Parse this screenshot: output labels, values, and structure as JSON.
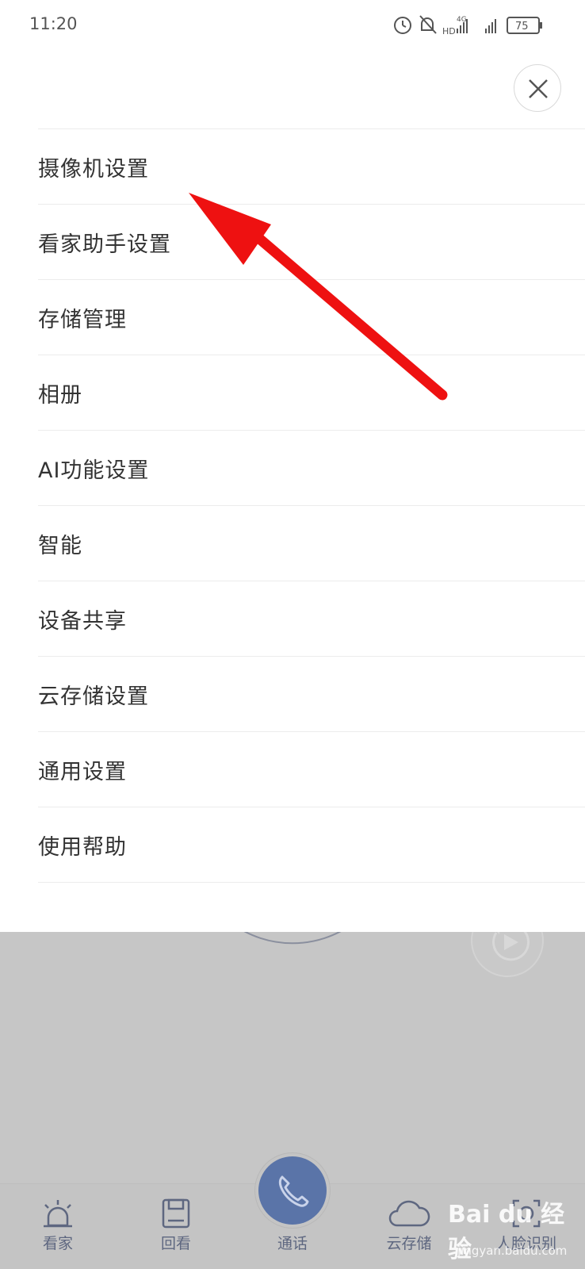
{
  "status_bar": {
    "time": "11:20",
    "network_label": "4G",
    "hd_label": "HD",
    "battery": "75"
  },
  "menu": {
    "items": [
      {
        "label": "摄像机设置"
      },
      {
        "label": "看家助手设置"
      },
      {
        "label": "存储管理"
      },
      {
        "label": "相册"
      },
      {
        "label": "AI功能设置"
      },
      {
        "label": "智能"
      },
      {
        "label": "设备共享"
      },
      {
        "label": "云存储设置"
      },
      {
        "label": "通用设置"
      },
      {
        "label": "使用帮助"
      }
    ]
  },
  "tabbar": {
    "tabs": [
      {
        "label": "看家",
        "icon": "alarm-light-icon"
      },
      {
        "label": "回看",
        "icon": "save-icon"
      },
      {
        "label": "通话",
        "icon": "phone-icon"
      },
      {
        "label": "云存储",
        "icon": "cloud-icon"
      },
      {
        "label": "人脸识别",
        "icon": "face-scan-icon"
      }
    ]
  },
  "watermark": {
    "logo_text": "Bai du 经验",
    "url": "jingyan.baidu.com"
  },
  "colors": {
    "accent": "#5a74a8",
    "annotation_arrow": "#ee1111",
    "overlay": "#c6c6c6"
  }
}
